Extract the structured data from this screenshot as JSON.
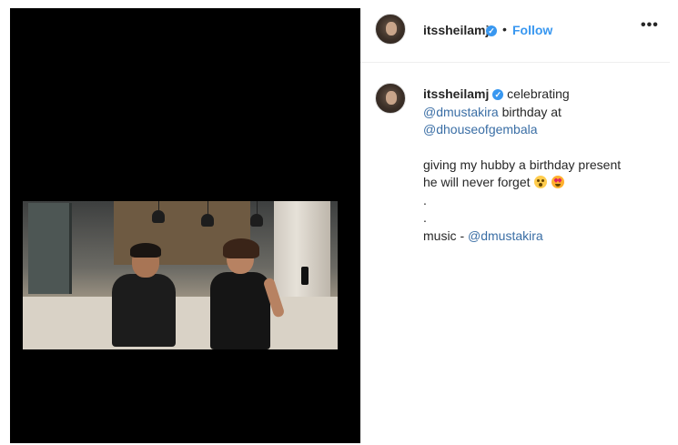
{
  "post": {
    "username": "itssheilamj",
    "verified_badge": "✓",
    "separator": "•",
    "follow_label": "Follow",
    "more_label": "•••"
  },
  "caption": {
    "username": "itssheilamj",
    "text_1": "celebrating",
    "mention_1": "@dmustakira",
    "text_2": "birthday at",
    "mention_2": "@dhouseofgembala",
    "text_3": "giving my hubby a birthday present",
    "text_4": "he will never forget",
    "dot_1": ".",
    "dot_2": ".",
    "text_5": "music - ",
    "mention_3": "@dmustakira"
  },
  "icons": {
    "verified": "verified-badge-icon",
    "more": "more-options-icon",
    "emoji_1": "grimacing-face-emoji",
    "emoji_2": "heart-eyes-emoji"
  },
  "colors": {
    "accent": "#3897f0",
    "media_background": "#000000",
    "text": "#262626",
    "mention": "#3a6ea5"
  }
}
